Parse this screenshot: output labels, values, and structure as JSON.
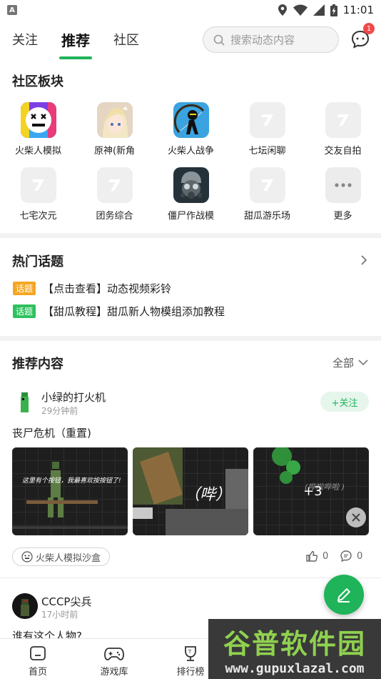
{
  "status_bar": {
    "time": "11:01",
    "app_icon": "A"
  },
  "top_nav": {
    "tabs": [
      {
        "label": "关注",
        "active": false
      },
      {
        "label": "推荐",
        "active": true
      },
      {
        "label": "社区",
        "active": false
      }
    ],
    "search_placeholder": "搜索动态内容",
    "message_badge": "1",
    "accent": "#1fb35a"
  },
  "boards": {
    "title": "社区板块",
    "items": [
      {
        "label": "火柴人模拟",
        "icon": "stickman-face-icon"
      },
      {
        "label": "原神(新角",
        "icon": "anime-girl-icon"
      },
      {
        "label": "火柴人战争",
        "icon": "stick-war-icon"
      },
      {
        "label": "七坛闲聊",
        "icon": "placeholder-7-icon"
      },
      {
        "label": "交友自拍",
        "icon": "placeholder-7-icon"
      },
      {
        "label": "七宅次元",
        "icon": "placeholder-7-icon"
      },
      {
        "label": "团务综合",
        "icon": "placeholder-7-icon"
      },
      {
        "label": "僵尸作战模",
        "icon": "gas-mask-icon"
      },
      {
        "label": "甜瓜游乐场",
        "icon": "placeholder-7-icon"
      },
      {
        "label": "更多",
        "icon": "more-dots-icon"
      }
    ]
  },
  "hot_topics": {
    "title": "热门话题",
    "items": [
      {
        "tag": "话题",
        "tag_color": "#f5a623",
        "text": "【点击查看】动态视频彩铃"
      },
      {
        "tag": "话题",
        "tag_color": "#2fc15f",
        "text": "【甜瓜教程】甜瓜新人物模组添加教程"
      }
    ]
  },
  "recommended": {
    "title": "推荐内容",
    "filter_label": "全部",
    "posts": [
      {
        "user": "小绿的打火机",
        "time": "29分钟前",
        "follow_label": "+关注",
        "title": "丧尸危机（重置)",
        "thumbs": [
          {
            "caption": "这里有个按钮，我最喜欢按按钮了!"
          },
          {
            "caption": "（哔）"
          },
          {
            "caption": "(哔啦哔啦 )",
            "more": "+3"
          }
        ],
        "tag": "火柴人模拟沙盒",
        "likes": "0",
        "comments": "0"
      },
      {
        "user": "CCCP尖兵",
        "time": "17小时前",
        "title": "谁有这个人物?"
      }
    ]
  },
  "bottom_nav": {
    "items": [
      {
        "label": "首页",
        "icon": "home-icon"
      },
      {
        "label": "游戏库",
        "icon": "gamepad-icon"
      },
      {
        "label": "排行榜",
        "icon": "trophy-icon"
      }
    ]
  },
  "watermark": {
    "cn": "谷普软件园",
    "url": "www.gupuxlazal.com"
  }
}
